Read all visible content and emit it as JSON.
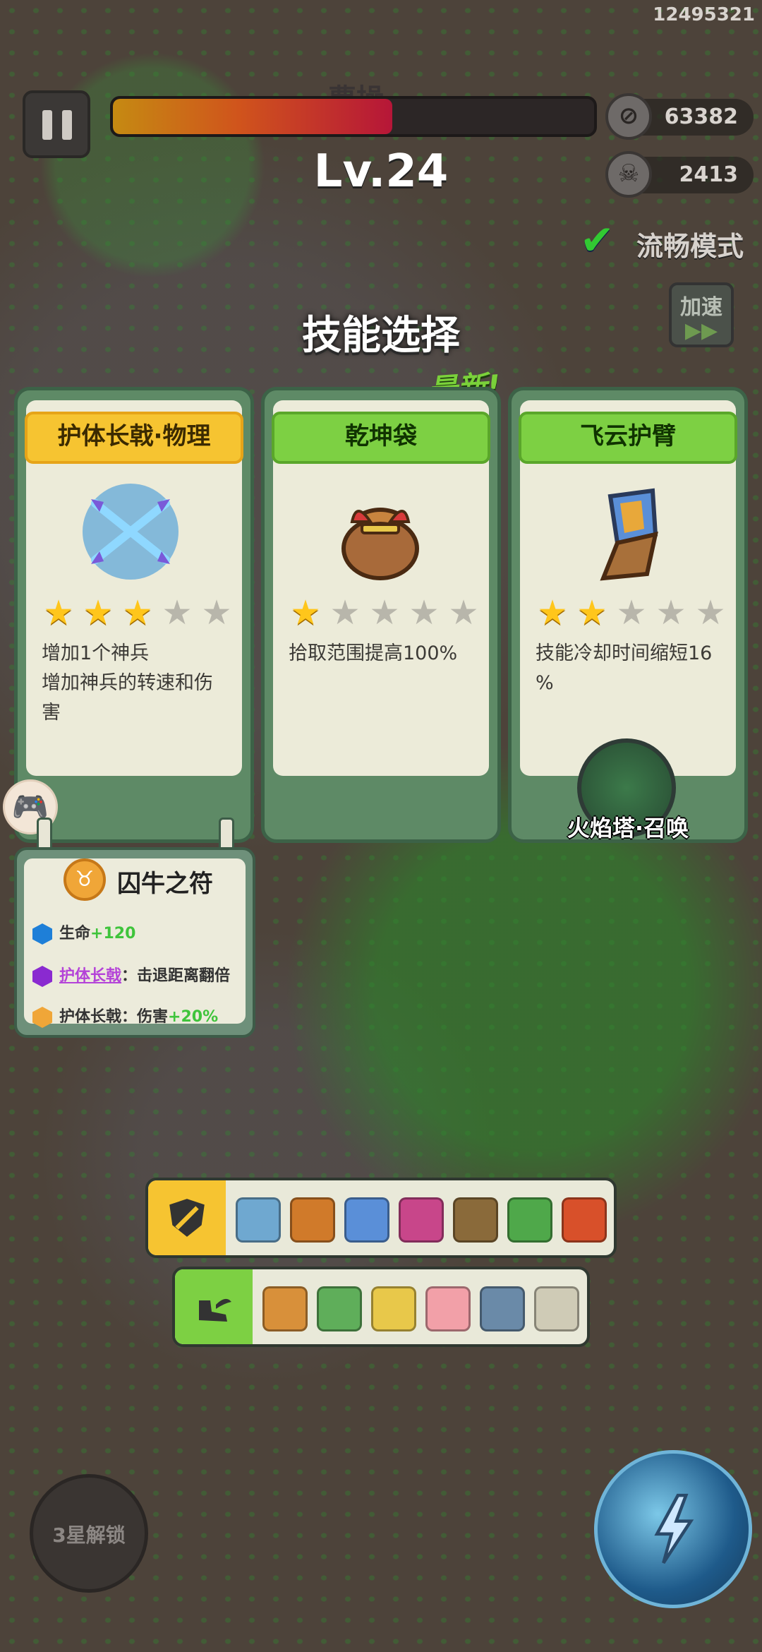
{
  "header": {
    "uid": "12495321",
    "boss_name": "曹操",
    "boss_hp_fraction": 0.58,
    "level": "Lv.24",
    "coins": "63382",
    "kills": "2413",
    "smooth_mode_label": "流畅模式",
    "speed_label": "加速",
    "speed_arrows": "▶▶"
  },
  "dialog": {
    "title": "技能选择",
    "new_tag": "最新!",
    "cards": [
      {
        "name": "护体长戟·物理",
        "ribbon_color": "#f6c431",
        "stars_on": 3,
        "stars_total": 5,
        "desc_lines": [
          "增加1个神兵",
          "增加神兵的转速和伤",
          "害"
        ]
      },
      {
        "name": "乾坤袋",
        "ribbon_color": "#7dd043",
        "stars_on": 1,
        "stars_total": 5,
        "desc_lines": [
          "拾取范围提高100%"
        ]
      },
      {
        "name": "飞云护臂",
        "ribbon_color": "#7dd043",
        "stars_on": 2,
        "stars_total": 5,
        "desc_lines": [
          "技能冷却时间缩短16",
          "%"
        ],
        "summon_label": "火焰塔·召唤"
      }
    ]
  },
  "talisman": {
    "name": "囚牛之符",
    "rows": [
      {
        "label": "生命",
        "value": "+120",
        "color": "#1e7fd8"
      },
      {
        "label": "护体长戟",
        "sep": "：",
        "value": "击退距离翻倍",
        "color": "#8a2ad0"
      },
      {
        "label": "护体长戟",
        "sep": "：",
        "value": "伤害",
        "bonus": "+20%",
        "color": "#f0a638"
      }
    ]
  },
  "weapons_bar": {
    "lead_icon": "shield-sword-icon",
    "lead_color": "#f6c431",
    "slots": [
      "#6fa8d0",
      "#d07a2a",
      "#5a8fd8",
      "#c8468a",
      "#8a6a3a",
      "#4fa84a",
      "#d8502a"
    ]
  },
  "passives_bar": {
    "lead_icon": "winged-boot-icon",
    "lead_color": "#7dd043",
    "slots": [
      "#d8903a",
      "#5fae5a",
      "#e8c84a",
      "#f2a0a8",
      "#6a8aa8",
      "#cfcbb6"
    ]
  },
  "bottom": {
    "lock_label": "3星解锁"
  }
}
